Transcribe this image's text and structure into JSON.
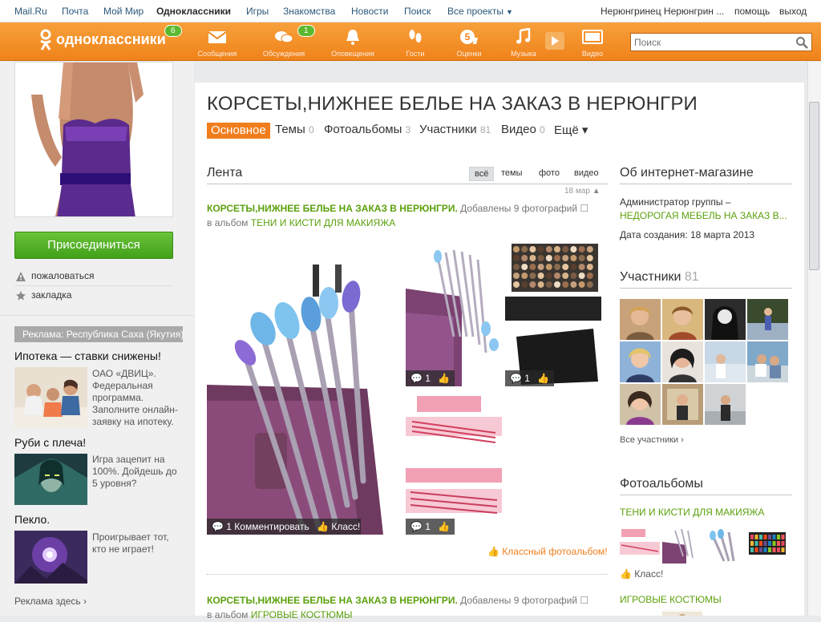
{
  "topbar": {
    "links": [
      "Mail.Ru",
      "Почта",
      "Мой Мир",
      "Одноклассники",
      "Игры",
      "Знакомства",
      "Новости",
      "Поиск",
      "Все проекты"
    ],
    "user": "Нерюнгринец Нерюнгрин ...",
    "help": "помощь",
    "logout": "выход"
  },
  "header": {
    "logo_text": "одноклассники",
    "logo_badge": "6",
    "nav": [
      {
        "label": "Сообщения",
        "icon": "envelope-icon"
      },
      {
        "label": "Обсуждения",
        "icon": "chat-bubbles-icon",
        "badge": "1"
      },
      {
        "label": "Оповещения",
        "icon": "bell-icon"
      },
      {
        "label": "Гости",
        "icon": "footprints-icon"
      },
      {
        "label": "Оценки",
        "icon": "rating-5-icon"
      },
      {
        "label": "Музыка",
        "icon": "music-note-icon"
      },
      {
        "label": "Видео",
        "icon": "video-icon"
      }
    ],
    "search_placeholder": "Поиск"
  },
  "left": {
    "join_button": "Присоединиться",
    "complain": "пожаловаться",
    "bookmark": "закладка",
    "ad_header": "Реклама: Республика Саха (Якутия)",
    "ads": [
      {
        "title": "Ипотека — ставки снижены!",
        "text": "ОАО «ДВИЦ». Федеральная программа. Заполните онлайн-заявку на ипотеку."
      },
      {
        "title": "Руби с плеча!",
        "text": "Игра зацепит на 100%. Дойдешь до 5 уровня?"
      },
      {
        "title": "Пекло.",
        "text": "Проигрывает тот, кто не играет!"
      }
    ],
    "ads_here": "Реклама здесь ›"
  },
  "group": {
    "title": "КОРСЕТЫ,НИЖНЕЕ БЕЛЬЕ НА ЗАКАЗ В НЕРЮНГРИ",
    "tabs": [
      {
        "label": "Основное",
        "count": ""
      },
      {
        "label": "Темы",
        "count": "0"
      },
      {
        "label": "Фотоальбомы",
        "count": "3"
      },
      {
        "label": "Участники",
        "count": "81"
      },
      {
        "label": "Видео",
        "count": "0"
      },
      {
        "label": "Ещё ▾",
        "count": ""
      }
    ]
  },
  "feed": {
    "heading": "Лента",
    "filters": [
      "всё",
      "темы",
      "фото",
      "видео"
    ],
    "date": "18 мар",
    "post1": {
      "group": "КОРСЕТЫ,НИЖНЕЕ БЕЛЬЕ НА ЗАКАЗ В НЕРЮНГРИ.",
      "action": "Добавлены 9 фотографий",
      "in_album": "в альбом",
      "album": "ТЕНИ И КИСТИ ДЛЯ МАКИЯЖА",
      "big_bar": "1 Комментировать",
      "klass": "Класс!",
      "count1": "1",
      "count2": "1",
      "count3": "1",
      "klass_album": "Классный фотоальбом!"
    },
    "post2": {
      "group": "КОРСЕТЫ,НИЖНЕЕ БЕЛЬЕ НА ЗАКАЗ В НЕРЮНГРИ.",
      "action": "Добавлены 9 фотографий",
      "in_album": "в альбом",
      "album": "ИГРОВЫЕ КОСТЮМЫ"
    }
  },
  "right": {
    "about_heading": "Об интернет-магазине",
    "admin_label": "Администратор группы –",
    "admin_name": "НЕДОРОГАЯ МЕБЕЛЬ НА ЗАКАЗ В...",
    "created": "Дата создания: 18 марта 2013",
    "members_heading": "Участники",
    "members_count": "81",
    "all_members": "Все участники ›",
    "albums_heading": "Фотоальбомы",
    "album1": "ТЕНИ И КИСТИ ДЛЯ МАКИЯЖА",
    "album1_klass": "Класс!",
    "album2": "ИГРОВЫЕ КОСТЮМЫ"
  },
  "colors": {
    "orange": "#f0821a",
    "green": "#5ca10d",
    "link": "#2b587a"
  }
}
